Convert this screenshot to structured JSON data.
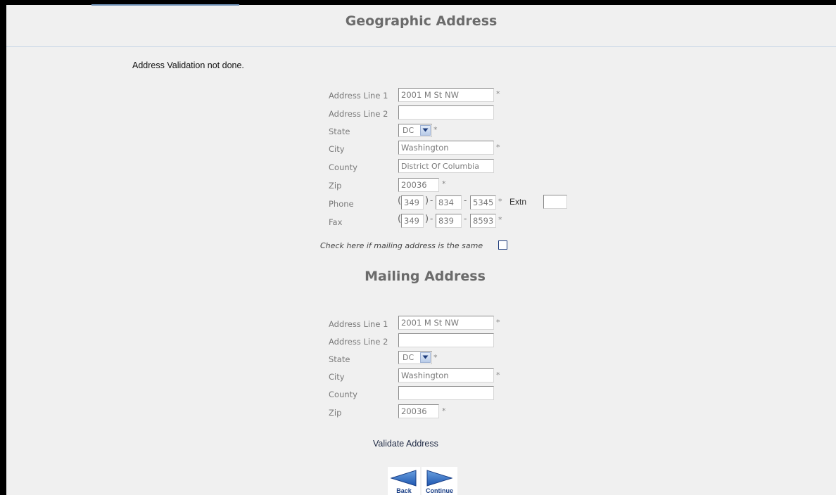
{
  "page": {
    "title": "Geographic Address",
    "validation_message": "Address Validation not done."
  },
  "geographic": {
    "labels": {
      "address1": "Address Line 1",
      "address2": "Address Line 2",
      "state": "State",
      "city": "City",
      "county": "County",
      "zip": "Zip",
      "phone": "Phone",
      "fax": "Fax",
      "extn": "Extn"
    },
    "address1": "2001 M St NW",
    "address2": "",
    "state": "DC",
    "city": "Washington",
    "county": "District Of Columbia",
    "zip": "20036",
    "phone": {
      "area": "349",
      "prefix": "834",
      "line": "5345",
      "extn": ""
    },
    "fax": {
      "area": "349",
      "prefix": "839",
      "line": "8593"
    }
  },
  "same_address_checkbox": {
    "label": "Check here if mailing address is the same",
    "checked": false
  },
  "mailing": {
    "title": "Mailing Address",
    "labels": {
      "address1": "Address Line 1",
      "address2": "Address Line 2",
      "state": "State",
      "city": "City",
      "county": "County",
      "zip": "Zip"
    },
    "address1": "2001 M St NW",
    "address2": "",
    "state": "DC",
    "city": "Washington",
    "county": "",
    "zip": "20036"
  },
  "symbols": {
    "required": "*",
    "open_paren": "(",
    "close_paren": ")",
    "dash": "-"
  },
  "actions": {
    "validate": "Validate Address",
    "back": "Back",
    "continue": "Continue"
  },
  "icons": {
    "back": "left-arrow-icon",
    "continue": "right-arrow-icon",
    "dropdown": "chevron-down-icon"
  },
  "colors": {
    "background": "#f0f0f0",
    "heading": "#6b6b6b",
    "label": "#7a7a7a",
    "nav_blue": "#1a3f86"
  }
}
